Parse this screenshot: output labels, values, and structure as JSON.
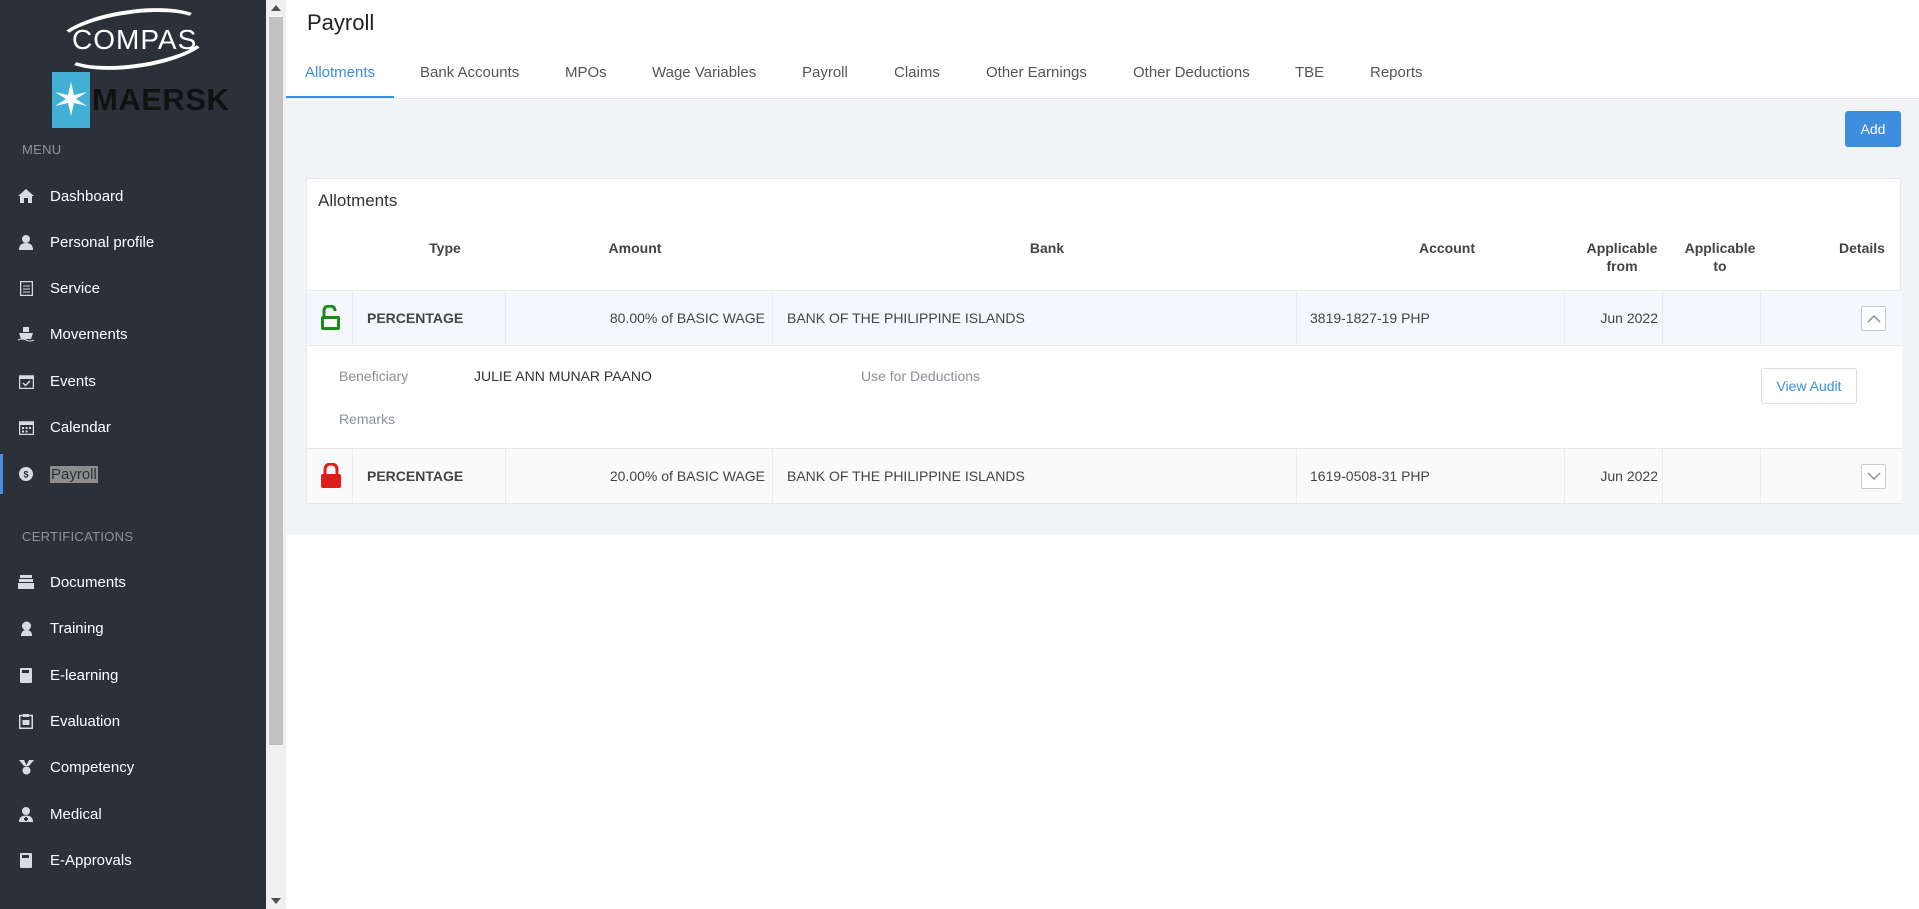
{
  "brand": {
    "compas_logo_text": "COMPAS",
    "maersk_logo_text": "MAERSK"
  },
  "sidebar": {
    "menu_label": "MENU",
    "menu_items": [
      {
        "label": "Dashboard",
        "icon": "home-icon"
      },
      {
        "label": "Personal profile",
        "icon": "user-icon"
      },
      {
        "label": "Service",
        "icon": "document-icon"
      },
      {
        "label": "Movements",
        "icon": "ship-icon"
      },
      {
        "label": "Events",
        "icon": "calendar-check-icon"
      },
      {
        "label": "Calendar",
        "icon": "calendar-icon"
      },
      {
        "label": "Payroll",
        "icon": "dollar-icon",
        "active": true
      }
    ],
    "certifications_label": "CERTIFICATIONS",
    "cert_items": [
      {
        "label": "Documents",
        "icon": "stack-icon"
      },
      {
        "label": "Training",
        "icon": "training-icon"
      },
      {
        "label": "E-learning",
        "icon": "book-icon"
      },
      {
        "label": "Evaluation",
        "icon": "clipboard-icon"
      },
      {
        "label": "Competency",
        "icon": "medal-icon"
      },
      {
        "label": "Medical",
        "icon": "medical-icon"
      },
      {
        "label": "E-Approvals",
        "icon": "book-icon"
      }
    ]
  },
  "header": {
    "title": "Payroll",
    "tabs": [
      {
        "label": "Allotments",
        "active": true
      },
      {
        "label": "Bank Accounts"
      },
      {
        "label": "MPOs"
      },
      {
        "label": "Wage Variables"
      },
      {
        "label": "Payroll"
      },
      {
        "label": "Claims"
      },
      {
        "label": "Other Earnings"
      },
      {
        "label": "Other Deductions"
      },
      {
        "label": "TBE"
      },
      {
        "label": "Reports"
      }
    ]
  },
  "toolbar": {
    "add_label": "Add"
  },
  "allotments": {
    "title": "Allotments",
    "columns": {
      "type": "Type",
      "amount": "Amount",
      "bank": "Bank",
      "account": "Account",
      "applicable_from_1": "Applicable",
      "applicable_from_2": "from",
      "applicable_to_1": "Applicable",
      "applicable_to_2": "to",
      "details": "Details"
    },
    "rows": [
      {
        "locked": false,
        "type": "PERCENTAGE",
        "amount": "80.00% of BASIC WAGE",
        "bank": "BANK OF THE PHILIPPINE ISLANDS",
        "account": "3819-1827-19 PHP",
        "applicable_from": "Jun 2022",
        "applicable_to": "",
        "expanded": true
      },
      {
        "locked": true,
        "type": "PERCENTAGE",
        "amount": "20.00% of BASIC WAGE",
        "bank": "BANK OF THE PHILIPPINE ISLANDS",
        "account": "1619-0508-31 PHP",
        "applicable_from": "Jun 2022",
        "applicable_to": "",
        "expanded": false
      }
    ],
    "detail": {
      "beneficiary_label": "Beneficiary",
      "beneficiary_value": "JULIE ANN MUNAR PAANO",
      "use_for_deductions_label": "Use for Deductions",
      "remarks_label": "Remarks",
      "view_audit_label": "View Audit"
    }
  },
  "colors": {
    "sidebar_bg": "#2b3039",
    "accent": "#3d8ee0",
    "unlocked": "#1a8a1a",
    "locked": "#e01b1b"
  }
}
